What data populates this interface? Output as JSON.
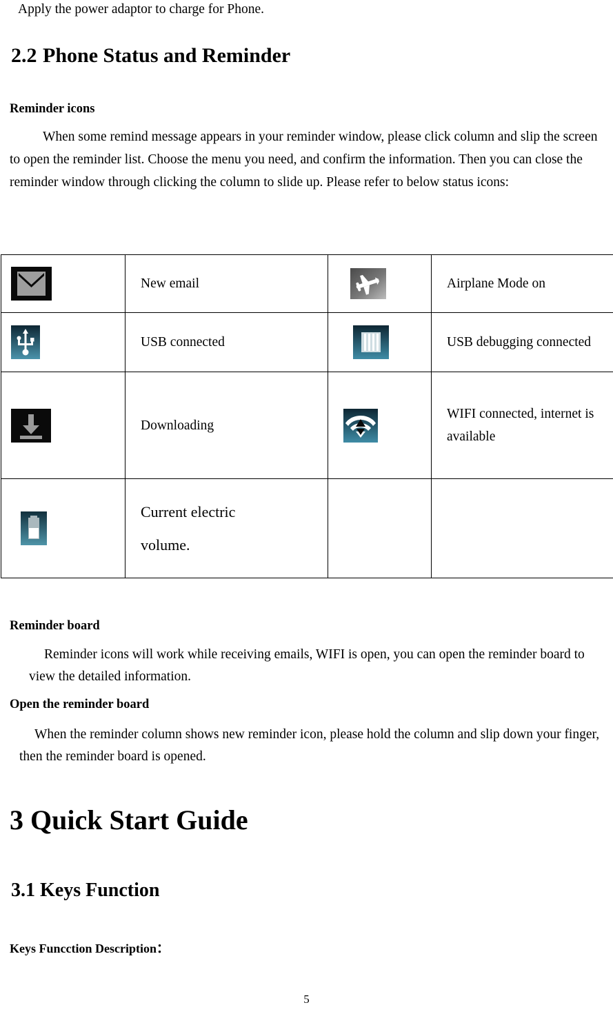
{
  "document": {
    "intro_line": "Apply the power adaptor to charge for Phone.",
    "section_number": "2.2",
    "section_title": "Phone Status and Reminder",
    "subheading_reminder_icons": "Reminder icons",
    "intro_paragraph": "When some remind message appears in your reminder window, please click column and slip the screen to open the reminder list. Choose the menu you need, and confirm the information. Then you can close the reminder window through clicking the column to slide up. Please refer to below status icons:",
    "subheading_reminder_board": "Reminder board",
    "reminder_board_paragraph": "Reminder icons will work while receiving emails, WIFI is open, you can open the reminder board to view the detailed information.",
    "subheading_open_board": "Open the reminder board",
    "open_board_paragraph": "When the reminder column shows new reminder icon, please hold the column and slip down your finger, then the reminder board is opened.",
    "chapter_heading": "3 Quick Start Guide",
    "section_31_heading": "3.1 Keys Function",
    "keys_description_heading": "Keys Funcction Description：",
    "page_number": "5"
  },
  "status_icon_table": {
    "rows": [
      {
        "left": {
          "icon": "new-email-icon",
          "label": "New email"
        },
        "right": {
          "icon": "airplane-mode-icon",
          "label": "Airplane Mode on"
        }
      },
      {
        "left": {
          "icon": "usb-connected-icon",
          "label": "USB connected"
        },
        "right": {
          "icon": "usb-debugging-icon",
          "label": "USB debugging connected"
        }
      },
      {
        "left": {
          "icon": "downloading-icon",
          "label": "Downloading"
        },
        "right": {
          "icon": "wifi-connected-icon",
          "label_line1": "WIFI connected, internet is",
          "label_line2": "available"
        }
      },
      {
        "left": {
          "icon": "battery-level-icon",
          "label_line1": "Current electric",
          "label_line2": "volume."
        },
        "right": {
          "icon": "",
          "label": ""
        }
      }
    ]
  },
  "colors": {
    "page_background": "#ffffff",
    "text": "#000000",
    "table_border": "#000000",
    "icon_dark": "#0a0a0a",
    "icon_gray": "#9a9a9a",
    "icon_teal_top": "#0f2d3d",
    "icon_teal_bottom": "#3f8ca6",
    "icon_white": "#ffffff"
  }
}
